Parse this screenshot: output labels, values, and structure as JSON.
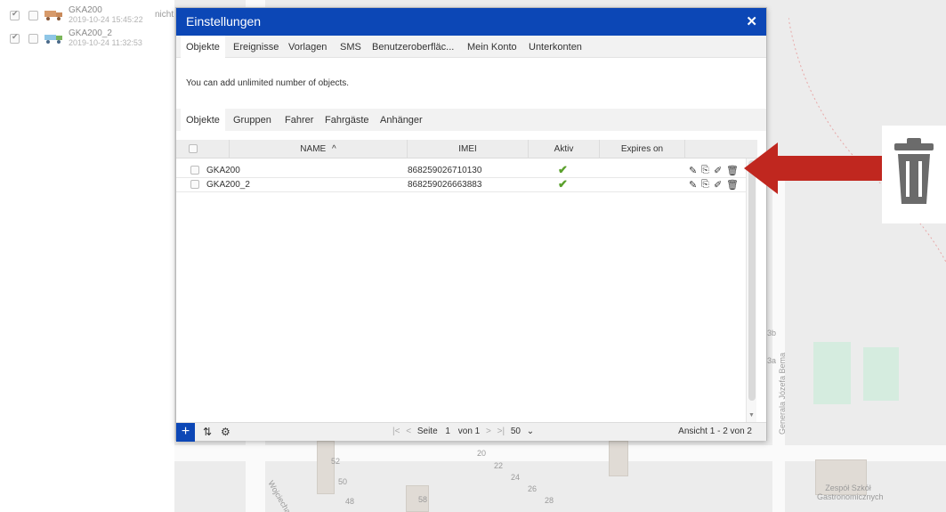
{
  "objects": [
    {
      "name": "GKA200",
      "date": "2019-10-24 15:45:22"
    },
    {
      "name": "GKA200_2",
      "date": "2019-10-24 11:32:53"
    }
  ],
  "truncated_status": "nicht",
  "map": {
    "street_1": "Generala Józefa Bema",
    "street_2": "Wojciecha G",
    "building_label": "Zespół Szkół Gastronomicznych",
    "house_numbers": [
      "52",
      "50",
      "48",
      "58",
      "20",
      "22",
      "24",
      "26",
      "28",
      "3b",
      "3a"
    ]
  },
  "dialog": {
    "title": "Einstellungen",
    "close_glyph": "✕",
    "main_tabs": [
      "Objekte",
      "Ereignisse",
      "Vorlagen",
      "SMS",
      "Benutzeroberfläc...",
      "Mein Konto",
      "Unterkonten"
    ],
    "info_text": "You can add unlimited number of objects.",
    "sub_tabs": [
      "Objekte",
      "Gruppen",
      "Fahrer",
      "Fahrgäste",
      "Anhänger"
    ],
    "grid": {
      "columns": {
        "name": "NAME",
        "sort_glyph": "^",
        "imei": "IMEI",
        "active": "Aktiv",
        "expires": "Expires on"
      },
      "rows": [
        {
          "name": "GKA200",
          "imei": "868259026710130",
          "active": true,
          "expires": ""
        },
        {
          "name": "GKA200_2",
          "imei": "868259026663883",
          "active": true,
          "expires": ""
        }
      ],
      "row_actions": [
        "edit-icon",
        "duplicate-icon",
        "clear-icon",
        "trash-icon"
      ]
    },
    "footer": {
      "add_glyph": "+",
      "page_label": "Seite",
      "page_value": "1",
      "page_of": "von 1",
      "page_size": "50",
      "view_text": "Ansicht 1 - 2 von 2"
    }
  },
  "colors": {
    "header_blue": "#0c47b6",
    "check_green": "#5aa02c",
    "arrow_red": "#c0271f"
  }
}
